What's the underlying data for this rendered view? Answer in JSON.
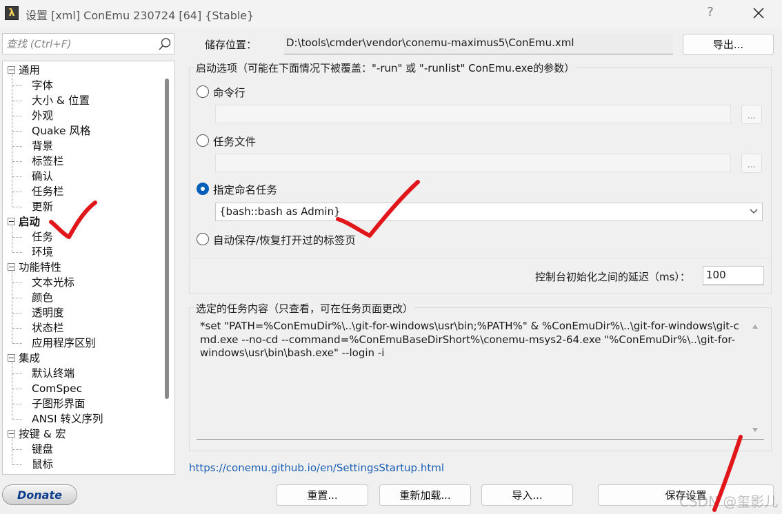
{
  "window": {
    "title": "设置 [xml] ConEmu 230724 [64] {Stable}",
    "app_icon": "λ",
    "help": "?"
  },
  "search": {
    "placeholder": "查找 (Ctrl+F)"
  },
  "tree": {
    "groups": [
      {
        "label": "通用",
        "bold": false,
        "children": [
          "字体",
          "大小 & 位置",
          "外观",
          "Quake 风格",
          "背景",
          "标签栏",
          "确认",
          "任务栏",
          "更新"
        ]
      },
      {
        "label": "启动",
        "bold": true,
        "children": [
          "任务",
          "环境"
        ]
      },
      {
        "label": "功能特性",
        "bold": false,
        "children": [
          "文本光标",
          "颜色",
          "透明度",
          "状态栏",
          "应用程序区别"
        ]
      },
      {
        "label": "集成",
        "bold": false,
        "children": [
          "默认终端",
          "ComSpec",
          "子图形界面",
          "ANSI 转义序列"
        ]
      },
      {
        "label": "按键 & 宏",
        "bold": false,
        "children": [
          "键盘",
          "鼠标"
        ]
      }
    ]
  },
  "storage": {
    "label": "储存位置：",
    "path": "D:\\tools\\cmder\\vendor\\conemu-maximus5\\ConEmu.xml",
    "export_label": "导出..."
  },
  "startup": {
    "group_title": "启动选项（可能在下面情况下被覆盖：\"-run\" 或 \"-runlist\" ConEmu.exe的参数）",
    "options": {
      "cmdline": "命令行",
      "taskfile": "任务文件",
      "named_task": "指定命名任务",
      "autosave": "自动保存/恢复打开过的标签页"
    },
    "selected": "named_task",
    "dots": "...",
    "named_task_value": "{bash::bash as Admin}",
    "delay_label": "控制台初始化之间的延迟（ms）：",
    "delay_value": "100"
  },
  "task_content": {
    "group_title": "选定的任务内容（只查看，可在任务页面更改）",
    "text": "*set \"PATH=%ConEmuDir%\\..\\git-for-windows\\usr\\bin;%PATH%\" & %ConEmuDir%\\..\\git-for-windows\\git-cmd.exe --no-cd --command=%ConEmuBaseDirShort%\\conemu-msys2-64.exe \"%ConEmuDir%\\..\\git-for-windows\\usr\\bin\\bash.exe\" --login -i"
  },
  "help_link": "https://conemu.github.io/en/SettingsStartup.html",
  "buttons": {
    "donate": "Donate",
    "reset": "重置...",
    "reload": "重新加载...",
    "import": "导入...",
    "save": "保存设置"
  },
  "watermark": "CSDN @玺影儿",
  "colors": {
    "accent": "#005fb8",
    "link": "#1a5fb4",
    "annotation": "#e0161b"
  }
}
